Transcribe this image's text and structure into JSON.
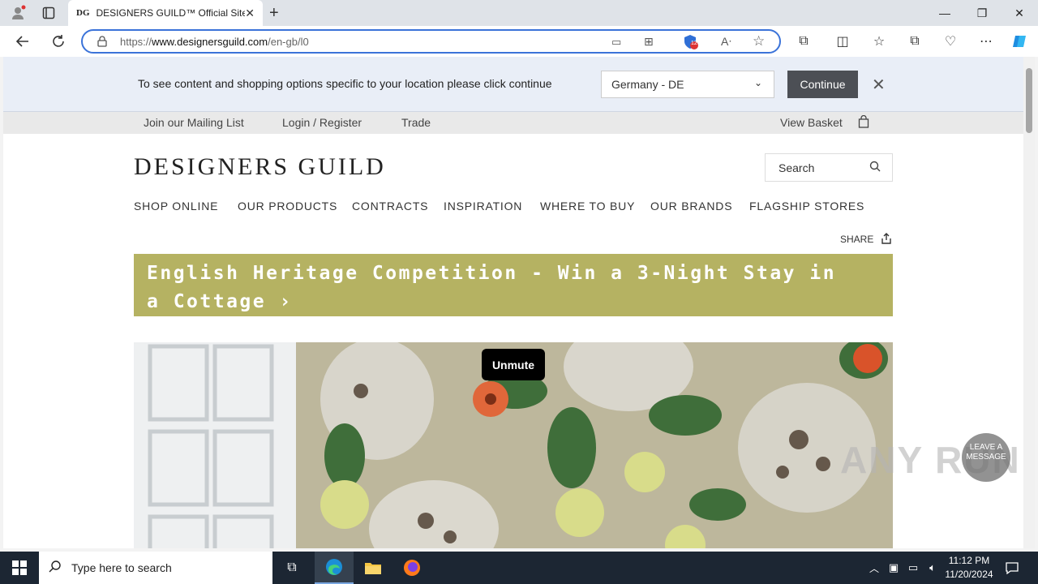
{
  "browser": {
    "tab_favicon": "DG",
    "tab_title": "DESIGNERS GUILD™ Official Site",
    "url_prefix": "https://",
    "url_host": "www.designersguild.com",
    "url_path": "/en-gb/l0",
    "tracker_count": "12"
  },
  "location_banner": {
    "message": "To see content and shopping options specific to your location please click continue",
    "selected_country": "Germany - DE",
    "continue_label": "Continue"
  },
  "util_bar": {
    "mailing_list": "Join our Mailing List",
    "login": "Login / Register",
    "trade": "Trade",
    "basket": "View Basket"
  },
  "header": {
    "logo": "DESIGNERS GUILD",
    "search_placeholder": "Search"
  },
  "nav": {
    "items": [
      "SHOP ONLINE",
      "OUR PRODUCTS",
      "CONTRACTS",
      "INSPIRATION",
      "WHERE TO BUY",
      "OUR BRANDS",
      "FLAGSHIP STORES"
    ]
  },
  "share_label": "SHARE",
  "promo_banner": {
    "line1": "English Heritage Competition - Win a 3-Night Stay in",
    "line2": "a Cottage ›"
  },
  "hero": {
    "unmute_label": "Unmute"
  },
  "overlay": {
    "watermark": "ANY RUN",
    "leave_message_line1": "LEAVE A",
    "leave_message_line2": "MESSAGE"
  },
  "taskbar": {
    "search_placeholder": "Type here to search",
    "time": "11:12 PM",
    "date": "11/20/2024"
  },
  "colors": {
    "promo_banner_bg": "#b5b262",
    "continue_button_bg": "#4c4f55",
    "address_border": "#3b73d9",
    "taskbar_bg": "#1c2633"
  }
}
